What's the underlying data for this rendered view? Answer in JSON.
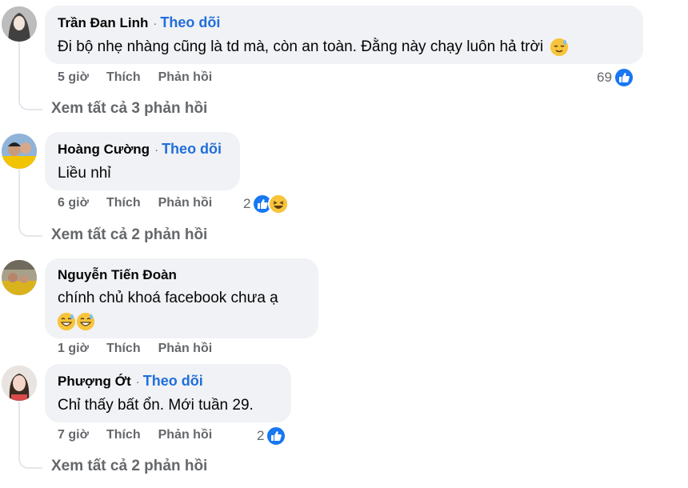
{
  "comments": [
    {
      "name": "Trần Đan Linh",
      "follow": "Theo dõi",
      "separator": "·",
      "text": "Đi bộ nhẹ nhàng cũng là td mà, còn an toàn. Đằng này chạy luôn hả trời",
      "emoji": "sweat-smile-emoji",
      "time": "5 giờ",
      "like": "Thích",
      "reply": "Phản hồi",
      "reaction_count": "69",
      "reactions": [
        "like"
      ],
      "view_replies": "Xem tất cả 3 phản hồi"
    },
    {
      "name": "Hoàng Cường",
      "follow": "Theo dõi",
      "separator": "·",
      "text": "Liều nhỉ",
      "time": "6 giờ",
      "like": "Thích",
      "reply": "Phản hồi",
      "reaction_count": "2",
      "reactions": [
        "like",
        "haha"
      ],
      "view_replies": "Xem tất cả 2 phản hồi"
    },
    {
      "name": "Nguyễn Tiến Đoàn",
      "text": "chính chủ khoá facebook chưa ạ",
      "emojis": [
        "grin-sweat-emoji",
        "grin-sweat-emoji"
      ],
      "time": "1 giờ",
      "like": "Thích",
      "reply": "Phản hồi"
    },
    {
      "name": "Phượng Ớt",
      "follow": "Theo dõi",
      "separator": "·",
      "text": "Chỉ thấy bất ổn. Mới tuần 29.",
      "time": "7 giờ",
      "like": "Thích",
      "reply": "Phản hồi",
      "reaction_count": "2",
      "reactions": [
        "like"
      ],
      "view_replies": "Xem tất cả 2 phản hồi"
    }
  ],
  "colors": {
    "bubble": "#f0f2f5",
    "follow": "#216fdb",
    "meta": "#65676b",
    "like": "#1877f2",
    "haha": "#f7b125"
  }
}
